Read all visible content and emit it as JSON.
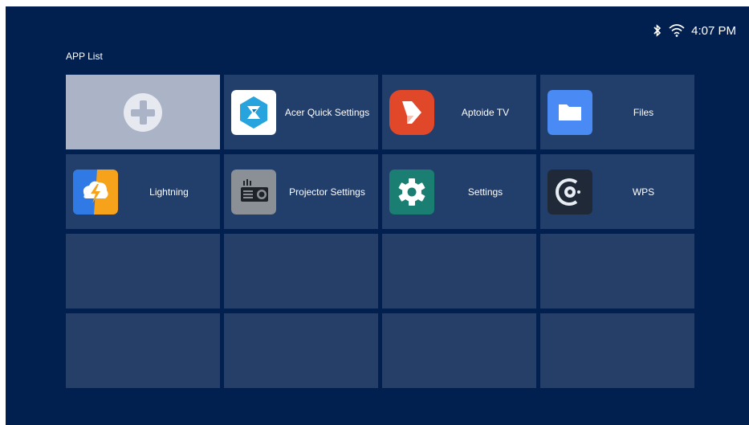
{
  "status": {
    "time": "4:07 PM",
    "bluetooth_icon": "bluetooth-icon",
    "wifi_icon": "wifi-icon"
  },
  "title": "APP List",
  "add_tile": {
    "icon": "add-icon"
  },
  "apps": [
    {
      "label": "Acer Quick Settings",
      "icon": "acer-quick-settings-icon",
      "color": "#ffffff"
    },
    {
      "label": "Aptoide TV",
      "icon": "aptoide-tv-icon",
      "color": "#e1482a"
    },
    {
      "label": "Files",
      "icon": "folder-icon",
      "color": "#4a8af4"
    },
    {
      "label": "Lightning",
      "icon": "lightning-icon",
      "color": "#f6a21a"
    },
    {
      "label": "Projector Settings",
      "icon": "projector-icon",
      "color": "#8b8f96"
    },
    {
      "label": "Settings",
      "icon": "gear-icon",
      "color": "#1a7f72"
    },
    {
      "label": "WPS",
      "icon": "wps-icon",
      "color": "#1f2937"
    }
  ],
  "colors": {
    "background": "#02204f",
    "tile": "#223e6b",
    "selected_tile": "#abb4c6"
  }
}
